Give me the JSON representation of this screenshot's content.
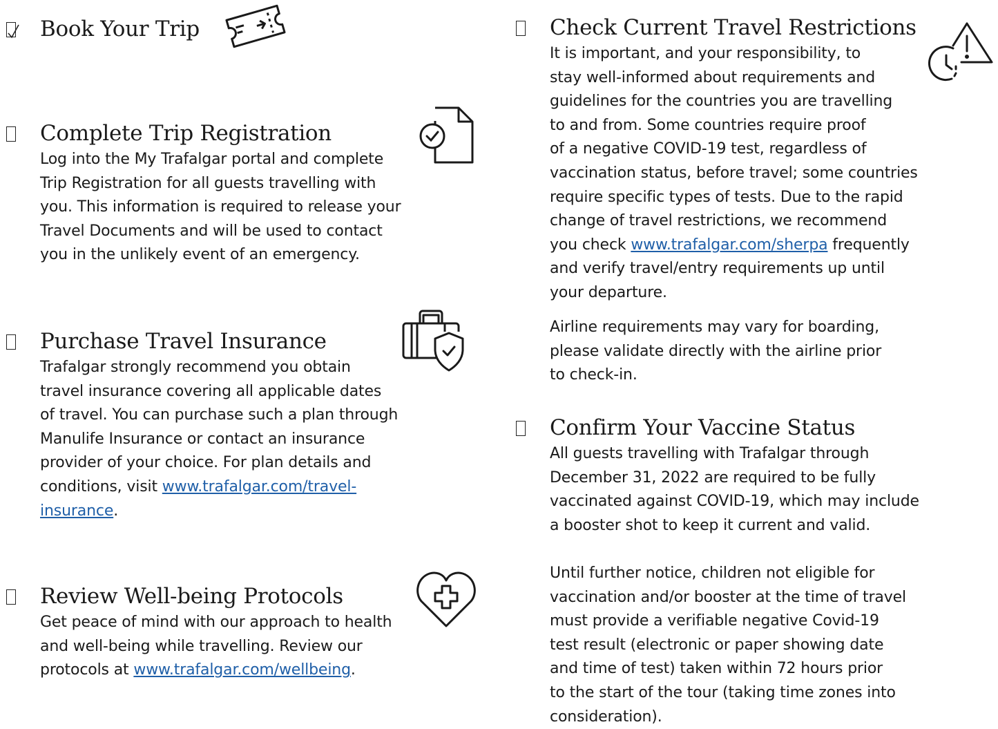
{
  "sections": [
    {
      "heading": "Book Your Trip",
      "checked": true,
      "icon": "ticket-icon"
    },
    {
      "heading": "Complete Trip Registration",
      "icon": "document-check-icon",
      "lines": [
        "Log into the My Trafalgar portal and complete",
        "Trip Registration for all guests travelling with",
        "you. This information is required to release your",
        "Travel Documents and will be used to contact",
        "you in the unlikely event of an emergency."
      ]
    },
    {
      "heading": "Purchase Travel Insurance",
      "icon": "suitcase-shield-icon",
      "lines": [
        "Trafalgar strongly recommend you obtain",
        "travel insurance covering all applicable dates",
        "of travel. You can purchase such a plan through",
        "Manulife Insurance or contact an insurance",
        "provider of your choice. For plan details and"
      ],
      "link_pre": "conditions, visit ",
      "link_part1": "www.trafalgar.com/travel-",
      "link_part2": "insurance",
      "link_post": "."
    },
    {
      "heading": "Review Well-being Protocols",
      "icon": "heart-cross-icon",
      "lines": [
        "Get peace of mind with our approach to health",
        "and well-being while travelling. Review our"
      ],
      "link_pre": "protocols at ",
      "link": "www.trafalgar.com/wellbeing",
      "link_post": "."
    },
    {
      "heading": "Check Current Travel Restrictions",
      "icon": "clock-warning-icon",
      "lines": [
        "It is important, and your responsibility, to",
        "stay well-informed about requirements and",
        "guidelines for the countries you are travelling",
        "to and from. Some countries require proof",
        "of a negative COVID-19 test, regardless of",
        "vaccination status, before travel; some countries",
        "require specific types of tests. Due to the rapid",
        "change of travel restrictions, we recommend"
      ],
      "link_pre": "you check ",
      "link": "www.trafalgar.com/sherpa",
      "link_post": " frequently",
      "lines_after": [
        "and verify travel/entry requirements up until",
        "your departure."
      ],
      "para2": [
        "Airline requirements may vary for boarding,",
        "please validate directly with the airline prior",
        "to check-in."
      ]
    },
    {
      "heading": "Confirm Your Vaccine Status",
      "lines": [
        "All guests travelling with Trafalgar through",
        "December 31, 2022 are required to be fully",
        "vaccinated against COVID-19, which may include",
        "a booster shot to keep it current and valid."
      ],
      "para2": [
        "Until further notice, children not eligible for",
        "vaccination and/or booster at the time of travel",
        "must provide a verifiable negative Covid-19",
        "test result (electronic or paper showing date",
        "and time of test) taken within 72 hours prior",
        "to the start of the tour (taking time zones into",
        "consideration)."
      ]
    }
  ]
}
